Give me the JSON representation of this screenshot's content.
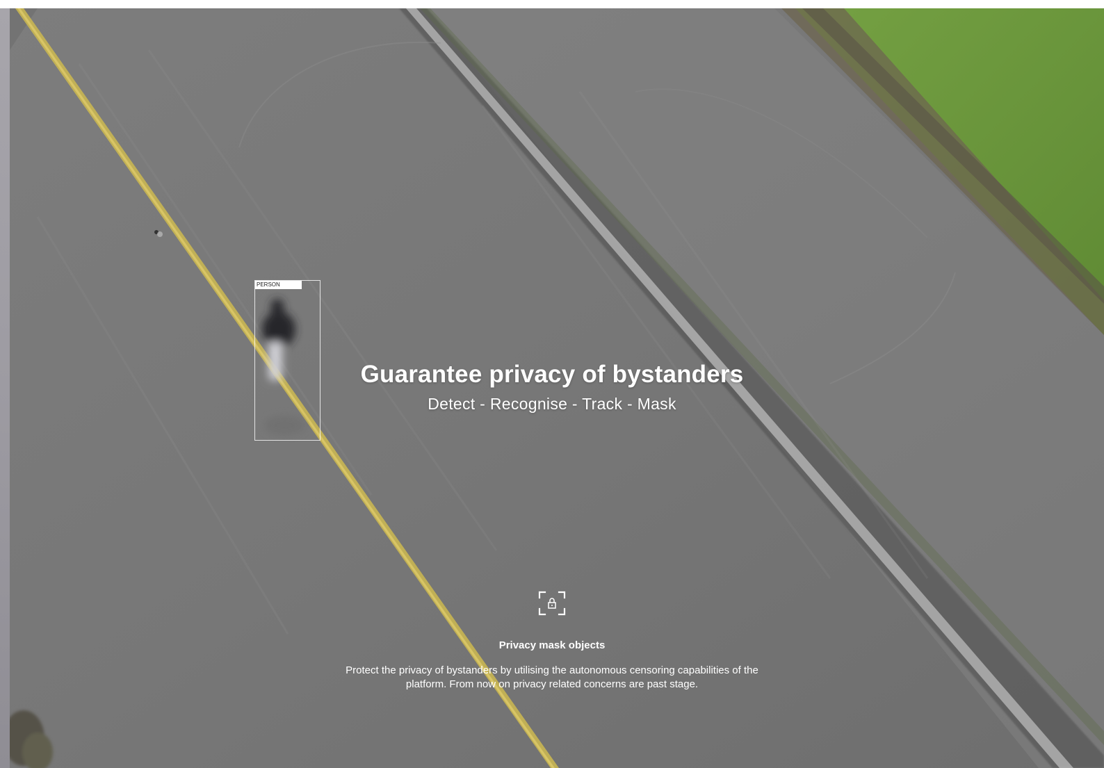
{
  "hero": {
    "title": "Guarantee privacy of bystanders",
    "subtitle": "Detect - Recognise - Track - Mask"
  },
  "detection": {
    "label": "PERSON"
  },
  "feature": {
    "icon": "lock-in-frame-icon",
    "title": "Privacy mask objects",
    "description": "Protect the privacy of bystanders by utilising the autonomous censoring capabilities of the platform. From now on privacy related concerns are past stage."
  },
  "colors": {
    "asphalt": "#7a7a7a",
    "grass": "#6f9a3c",
    "lane_line": "#c8b450",
    "text": "#ffffff"
  }
}
